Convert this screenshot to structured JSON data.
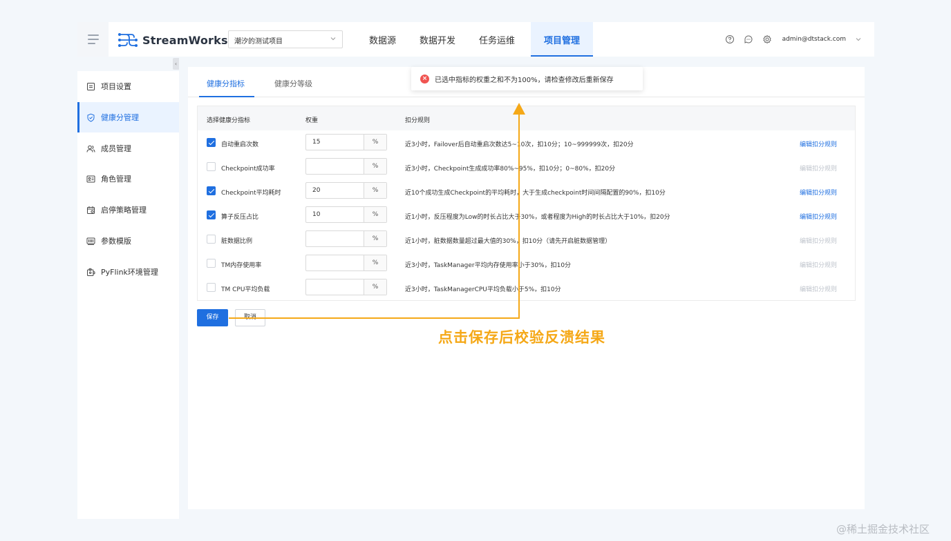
{
  "header": {
    "app_name": "StreamWorks",
    "project_select": "潮汐的测试项目",
    "nav": [
      "数据源",
      "数据开发",
      "任务运维",
      "项目管理"
    ],
    "active_nav": "项目管理",
    "user": "admin@dtstack.com"
  },
  "sidebar": {
    "items": [
      {
        "label": "项目设置",
        "icon": "settings-doc-icon"
      },
      {
        "label": "健康分管理",
        "icon": "shield-icon"
      },
      {
        "label": "成员管理",
        "icon": "users-icon"
      },
      {
        "label": "角色管理",
        "icon": "id-card-icon"
      },
      {
        "label": "启停策略管理",
        "icon": "calendar-icon"
      },
      {
        "label": "参数模版",
        "icon": "template-icon"
      },
      {
        "label": "PyFlink环境管理",
        "icon": "puzzle-icon"
      }
    ],
    "active_index": 1
  },
  "tabs": [
    "健康分指标",
    "健康分等级"
  ],
  "table": {
    "headers": [
      "选择健康分指标",
      "权重",
      "扣分规则"
    ],
    "unit": "%",
    "edit_label": "编辑扣分规则",
    "rows": [
      {
        "checked": true,
        "name": "自动重启次数",
        "weight": "15",
        "rule": "近3小时，Failover后自动重启次数达5~10次，扣10分；10~999999次，扣20分"
      },
      {
        "checked": false,
        "name": "Checkpoint成功率",
        "weight": "",
        "rule": "近3小时，Checkpoint生成成功率80%~95%，扣10分；0~80%，扣20分"
      },
      {
        "checked": true,
        "name": "Checkpoint平均耗时",
        "weight": "20",
        "rule": "近10个成功生成Checkpoint的平均耗时，大于生成checkpoint时间间隔配置的90%，扣10分"
      },
      {
        "checked": true,
        "name": "算子反压占比",
        "weight": "10",
        "rule": "近1小时，反压程度为Low的时长占比大于30%，或者程度为High的时长占比大于10%，扣20分"
      },
      {
        "checked": false,
        "name": "脏数据比例",
        "weight": "",
        "rule": "近1小时，脏数据数量超过最大值的30%，扣10分（请先开启脏数据管理）"
      },
      {
        "checked": false,
        "name": "TM内存使用率",
        "weight": "",
        "rule": "近3小时，TaskManager平均内存使用率小于30%，扣10分"
      },
      {
        "checked": false,
        "name": "TM CPU平均负载",
        "weight": "",
        "rule": "近3小时，TaskManagerCPU平均负载小于5%，扣10分"
      }
    ]
  },
  "buttons": {
    "save": "保存",
    "cancel": "取消"
  },
  "toast": {
    "message": "已选中指标的权重之和不为100%，请检查修改后重新保存"
  },
  "annotation": {
    "text": "点击保存后校验反溃结果",
    "color": "#f5a817"
  },
  "watermark": "@稀土掘金技术社区",
  "colors": {
    "accent": "#1f6fe0",
    "error": "#f05451",
    "annotation": "#f5a817"
  }
}
